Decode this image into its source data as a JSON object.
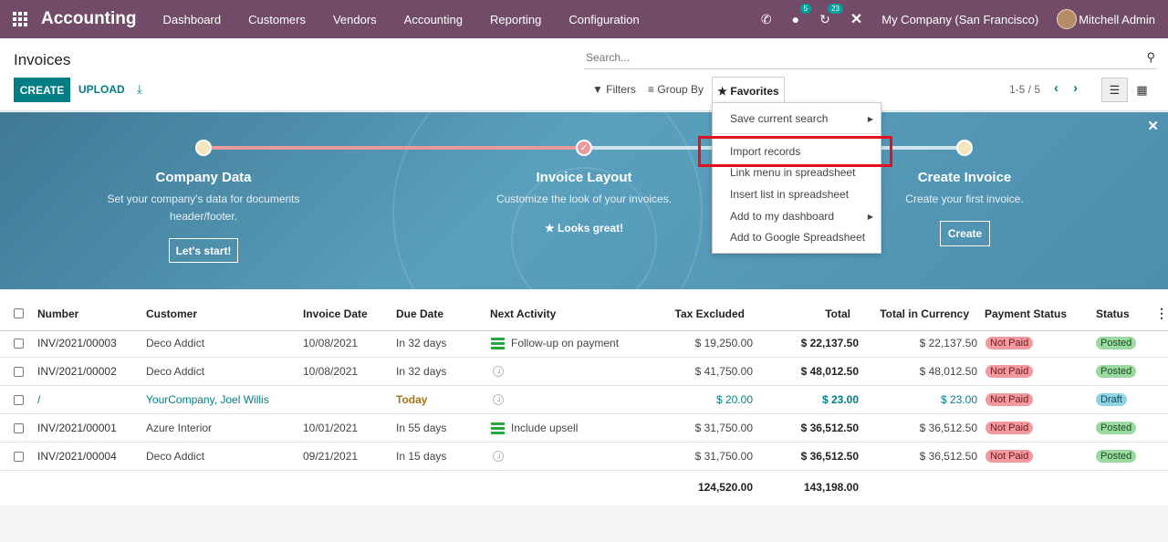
{
  "navbar": {
    "brand": "Accounting",
    "menu": [
      "Dashboard",
      "Customers",
      "Vendors",
      "Accounting",
      "Reporting",
      "Configuration"
    ],
    "messages_badge": "5",
    "activities_badge": "23",
    "company": "My Company (San Francisco)",
    "user": "Mitchell Admin"
  },
  "control_panel": {
    "title": "Invoices",
    "create_label": "CREATE",
    "upload_label": "UPLOAD",
    "search_placeholder": "Search...",
    "filters_label": "Filters",
    "group_by_label": "Group By",
    "favorites_label": "Favorites",
    "pager": "1-5 / 5"
  },
  "favorites_menu": {
    "items": [
      "Save current search",
      "Import records",
      "Link menu in spreadsheet",
      "Insert list in spreadsheet",
      "Add to my dashboard",
      "Add to Google Spreadsheet"
    ]
  },
  "banner": {
    "steps": [
      {
        "title": "Company Data",
        "desc": "Set your company's data for documents header/footer.",
        "button": "Let's start!"
      },
      {
        "title": "Invoice Layout",
        "desc": "Customize the look of your invoices.",
        "done_label": "Looks great!"
      },
      {
        "title": "Create Invoice",
        "desc": "Create your first invoice.",
        "button": "Create"
      }
    ]
  },
  "table": {
    "columns": [
      "Number",
      "Customer",
      "Invoice Date",
      "Due Date",
      "Next Activity",
      "Tax Excluded",
      "Total",
      "Total in Currency",
      "Payment Status",
      "Status"
    ],
    "rows": [
      {
        "number": "INV/2021/00003",
        "customer": "Deco Addict",
        "invoice_date": "10/08/2021",
        "due_date": "In 32 days",
        "activity": "Follow-up on payment",
        "tax_excluded": "$ 19,250.00",
        "total": "$ 22,137.50",
        "total_currency": "$ 22,137.50",
        "payment_status": "Not Paid",
        "status": "Posted"
      },
      {
        "number": "INV/2021/00002",
        "customer": "Deco Addict",
        "invoice_date": "10/08/2021",
        "due_date": "In 32 days",
        "activity": "",
        "tax_excluded": "$ 41,750.00",
        "total": "$ 48,012.50",
        "total_currency": "$ 48,012.50",
        "payment_status": "Not Paid",
        "status": "Posted"
      },
      {
        "number": "/",
        "customer": "YourCompany, Joel Willis",
        "invoice_date": "",
        "due_date": "Today",
        "activity": "",
        "tax_excluded": "$ 20.00",
        "total": "$ 23.00",
        "total_currency": "$ 23.00",
        "payment_status": "Not Paid",
        "status": "Draft"
      },
      {
        "number": "INV/2021/00001",
        "customer": "Azure Interior",
        "invoice_date": "10/01/2021",
        "due_date": "In 55 days",
        "activity": "Include upsell",
        "tax_excluded": "$ 31,750.00",
        "total": "$ 36,512.50",
        "total_currency": "$ 36,512.50",
        "payment_status": "Not Paid",
        "status": "Posted"
      },
      {
        "number": "INV/2021/00004",
        "customer": "Deco Addict",
        "invoice_date": "09/21/2021",
        "due_date": "In 15 days",
        "activity": "",
        "tax_excluded": "$ 31,750.00",
        "total": "$ 36,512.50",
        "total_currency": "$ 36,512.50",
        "payment_status": "Not Paid",
        "status": "Posted"
      }
    ],
    "totals": {
      "tax_excluded": "124,520.00",
      "total": "143,198.00"
    }
  },
  "colors": {
    "navbar": "#714b67",
    "primary": "#017e84",
    "highlight": "#e3121a"
  }
}
